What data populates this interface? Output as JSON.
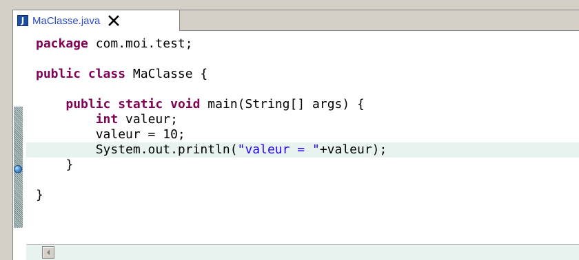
{
  "editor": {
    "tab": {
      "title": "MaClasse.java",
      "icon": "java-file-icon",
      "icon_letter": "J",
      "close_icon": "close-icon"
    },
    "code_lines": [
      [
        {
          "t": "package",
          "k": "kw"
        },
        {
          "t": " com.moi.test;"
        }
      ],
      [],
      [
        {
          "t": "public",
          "k": "kw"
        },
        {
          "t": " "
        },
        {
          "t": "class",
          "k": "kw"
        },
        {
          "t": " MaClasse {"
        }
      ],
      [],
      [
        {
          "t": "    "
        },
        {
          "t": "public",
          "k": "kw"
        },
        {
          "t": " "
        },
        {
          "t": "static",
          "k": "kw"
        },
        {
          "t": " "
        },
        {
          "t": "void",
          "k": "kw"
        },
        {
          "t": " main(String[] args) {"
        }
      ],
      [
        {
          "t": "        "
        },
        {
          "t": "int",
          "k": "kw"
        },
        {
          "t": " valeur;"
        }
      ],
      [
        {
          "t": "        valeur = 10;"
        }
      ],
      [
        {
          "t": "        System.out.println("
        },
        {
          "t": "\"valeur = \"",
          "k": "str"
        },
        {
          "t": "+valeur);"
        }
      ],
      [
        {
          "t": "    }"
        }
      ],
      [],
      [
        {
          "t": "}"
        }
      ]
    ],
    "highlighted_line": 7,
    "breakpoint_line": 6,
    "colors": {
      "keyword": "#7f0055",
      "string": "#2a00ff",
      "line_highlight": "#e8f2ee",
      "tab_text": "#2b49c8"
    },
    "scrollbar": {
      "left_arrow_icon": "scroll-left-arrow-icon"
    }
  }
}
